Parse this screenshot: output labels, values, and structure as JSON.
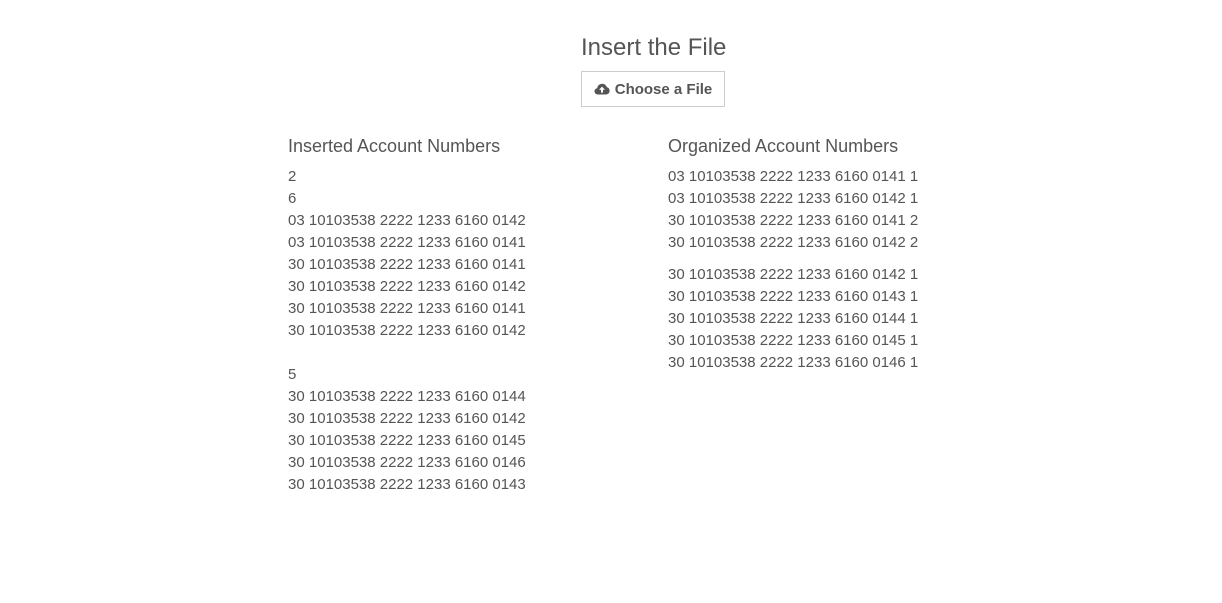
{
  "header": {
    "title": "Insert the File",
    "choose_file_label": "Choose a File",
    "upload_icon": "cloud-upload-icon"
  },
  "inserted": {
    "title": "Inserted Account Numbers",
    "groups": [
      [
        "2"
      ],
      [
        "6",
        "03 10103538 2222 1233 6160 0142",
        "03 10103538 2222 1233 6160 0141",
        "30 10103538 2222 1233 6160 0141",
        "30 10103538 2222 1233 6160 0142",
        "30 10103538 2222 1233 6160 0141",
        "30 10103538 2222 1233 6160 0142"
      ],
      [
        "5",
        "30 10103538 2222 1233 6160 0144",
        "30 10103538 2222 1233 6160 0142",
        "30 10103538 2222 1233 6160 0145",
        "30 10103538 2222 1233 6160 0146",
        "30 10103538 2222 1233 6160 0143"
      ]
    ]
  },
  "organized": {
    "title": "Organized Account Numbers",
    "groups": [
      [
        "03 10103538 2222 1233 6160 0141 1",
        "03 10103538 2222 1233 6160 0142 1",
        "30 10103538 2222 1233 6160 0141 2",
        "30 10103538 2222 1233 6160 0142 2"
      ],
      [
        "30 10103538 2222 1233 6160 0142 1",
        "30 10103538 2222 1233 6160 0143 1",
        "30 10103538 2222 1233 6160 0144 1",
        "30 10103538 2222 1233 6160 0145 1",
        "30 10103538 2222 1233 6160 0146 1"
      ]
    ]
  }
}
